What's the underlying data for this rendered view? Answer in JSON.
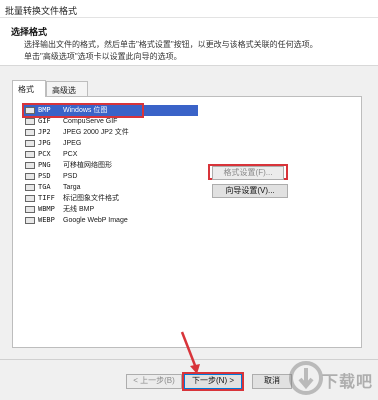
{
  "window": {
    "title": "批量转换文件格式"
  },
  "header": {
    "title": "选择格式",
    "desc_line1": "选择输出文件的格式，然后单击\"格式设置\"按钮，以更改与该格式关联的任何选项。",
    "desc_line2": "单击\"高级选项\"选项卡以设置此向导的选项。"
  },
  "tabs": [
    {
      "label": "格式",
      "active": true
    },
    {
      "label": "高级选项",
      "active": false
    }
  ],
  "formats": [
    {
      "code": "BMP",
      "desc": "Windows 位图",
      "selected": true,
      "icon": "bmp-icon"
    },
    {
      "code": "GIF",
      "desc": "CompuServe GIF",
      "selected": false,
      "icon": "gif-icon"
    },
    {
      "code": "JP2",
      "desc": "JPEG 2000 JP2 文件",
      "selected": false,
      "icon": "jp2-icon"
    },
    {
      "code": "JPG",
      "desc": "JPEG",
      "selected": false,
      "icon": "jpg-icon"
    },
    {
      "code": "PCX",
      "desc": "PCX",
      "selected": false,
      "icon": "pcx-icon"
    },
    {
      "code": "PNG",
      "desc": "可移植网络图形",
      "selected": false,
      "icon": "png-icon"
    },
    {
      "code": "PSD",
      "desc": "PSD",
      "selected": false,
      "icon": "psd-icon"
    },
    {
      "code": "TGA",
      "desc": "Targa",
      "selected": false,
      "icon": "tga-icon"
    },
    {
      "code": "TIFF",
      "desc": "标记图象文件格式",
      "selected": false,
      "icon": "tiff-icon"
    },
    {
      "code": "WBMP",
      "desc": "无线 BMP",
      "selected": false,
      "icon": "wbmp-icon"
    },
    {
      "code": "WEBP",
      "desc": "Google WebP Image",
      "selected": false,
      "icon": "webp-icon"
    }
  ],
  "buttons": {
    "format_settings": "格式设置(F)...",
    "wizard_settings": "向导设置(V)...",
    "prev": "< 上一步(B)",
    "next": "下一步(N) >",
    "cancel": "取消"
  },
  "watermark": {
    "text": "下载吧"
  },
  "colors": {
    "highlight_red": "#d8343a",
    "selection_blue": "#3a63c8"
  }
}
